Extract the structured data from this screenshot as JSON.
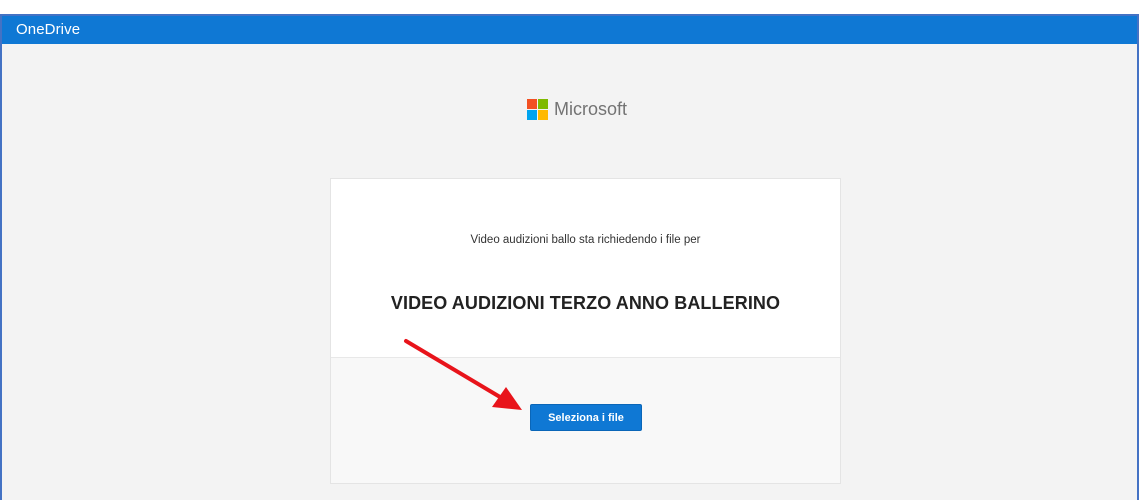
{
  "appbar": {
    "title": "OneDrive",
    "color": "#0f78d4"
  },
  "brand": {
    "name": "Microsoft",
    "logo_icon": "microsoft-four-squares-icon",
    "logo_colors": [
      "#f25022",
      "#7fba00",
      "#00a4ef",
      "#ffb900"
    ]
  },
  "request": {
    "message": "Video audizioni ballo sta richiedendo i file per",
    "title": "VIDEO AUDIZIONI TERZO ANNO BALLERINO",
    "select_button_label": "Seleziona i file"
  },
  "annotation": {
    "arrow_icon": "red-arrow-icon",
    "arrow_color": "#e8141b"
  }
}
